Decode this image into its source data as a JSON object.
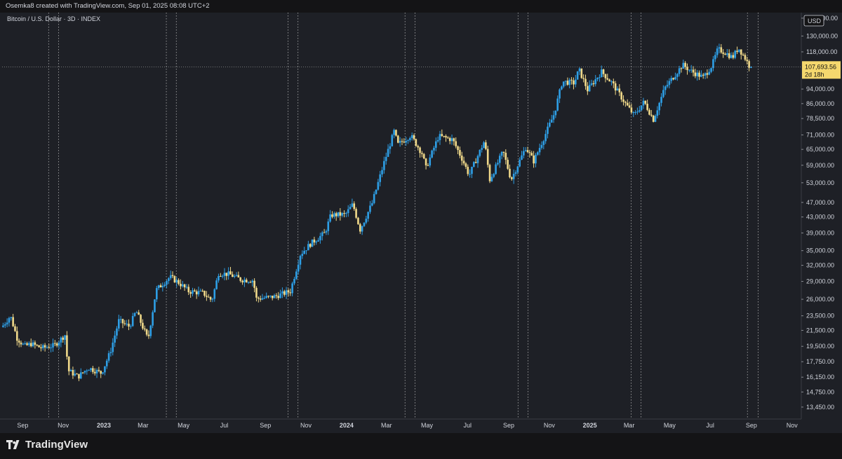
{
  "header": {
    "credit": "Osemka8 created with TradingView.com, Sep 01, 2025 08:08 UTC+2"
  },
  "footer": {
    "brand": "TradingView"
  },
  "colors": {
    "background": "#1e2026",
    "up": "#2e9fe6",
    "down": "#f0d98a",
    "grid": "#c8c8c8",
    "last_price_bg": "#f5d86e"
  },
  "chart_data": {
    "type": "candlestick",
    "title": "Bitcoin / U.S. Dollar · 3D · INDEX",
    "currency": "USD",
    "y_scale": "log",
    "ylim": [
      12500,
      150000
    ],
    "y_ticks": [
      "145,000.00",
      "130,000.00",
      "118,000.00",
      "94,000.00",
      "86,000.00",
      "78,500.00",
      "71,000.00",
      "65,000.00",
      "59,000.00",
      "53,000.00",
      "47,000.00",
      "43,000.00",
      "39,000.00",
      "35,000.00",
      "32,000.00",
      "29,000.00",
      "26,000.00",
      "23,500.00",
      "21,500.00",
      "19,500.00",
      "17,750.00",
      "16,150.00",
      "14,750.00",
      "13,450.00"
    ],
    "x_ticks": [
      {
        "date": "2022-09-01",
        "label": "Sep",
        "bold": false
      },
      {
        "date": "2022-11-01",
        "label": "Nov",
        "bold": false
      },
      {
        "date": "2023-01-01",
        "label": "2023",
        "bold": true
      },
      {
        "date": "2023-03-01",
        "label": "Mar",
        "bold": false
      },
      {
        "date": "2023-05-01",
        "label": "May",
        "bold": false
      },
      {
        "date": "2023-07-01",
        "label": "Jul",
        "bold": false
      },
      {
        "date": "2023-09-01",
        "label": "Sep",
        "bold": false
      },
      {
        "date": "2023-11-01",
        "label": "Nov",
        "bold": false
      },
      {
        "date": "2024-01-01",
        "label": "2024",
        "bold": true
      },
      {
        "date": "2024-03-01",
        "label": "Mar",
        "bold": false
      },
      {
        "date": "2024-05-01",
        "label": "May",
        "bold": false
      },
      {
        "date": "2024-07-01",
        "label": "Jul",
        "bold": false
      },
      {
        "date": "2024-09-01",
        "label": "Sep",
        "bold": false
      },
      {
        "date": "2024-11-01",
        "label": "Nov",
        "bold": false
      },
      {
        "date": "2025-01-01",
        "label": "2025",
        "bold": true
      },
      {
        "date": "2025-03-01",
        "label": "Mar",
        "bold": false
      },
      {
        "date": "2025-05-01",
        "label": "May",
        "bold": false
      },
      {
        "date": "2025-07-01",
        "label": "Jul",
        "bold": false
      },
      {
        "date": "2025-09-01",
        "label": "Sep",
        "bold": false
      },
      {
        "date": "2025-11-01",
        "label": "Nov",
        "bold": false
      }
    ],
    "x_range": [
      "2022-08-01",
      "2025-11-15"
    ],
    "vertical_markers": [
      "2022-10-10",
      "2022-10-25",
      "2023-04-05",
      "2023-04-20",
      "2023-10-05",
      "2023-10-20",
      "2024-03-29",
      "2024-04-13",
      "2024-09-15",
      "2024-09-30",
      "2025-03-04",
      "2025-03-19",
      "2025-08-26",
      "2025-09-11"
    ],
    "last_price": "107,693.56",
    "last_price_value": 107693.56,
    "countdown": "2d 18h",
    "price_path": [
      [
        "2022-08-01",
        21800
      ],
      [
        "2022-08-15",
        23500
      ],
      [
        "2022-08-25",
        20500
      ],
      [
        "2022-09-05",
        19500
      ],
      [
        "2022-09-15",
        19800
      ],
      [
        "2022-10-01",
        19300
      ],
      [
        "2022-10-20",
        19600
      ],
      [
        "2022-11-05",
        20900
      ],
      [
        "2022-11-10",
        16800
      ],
      [
        "2022-11-25",
        16200
      ],
      [
        "2022-12-10",
        17100
      ],
      [
        "2022-12-30",
        16550
      ],
      [
        "2023-01-12",
        18800
      ],
      [
        "2023-01-25",
        22800
      ],
      [
        "2023-02-10",
        22000
      ],
      [
        "2023-02-20",
        24200
      ],
      [
        "2023-03-10",
        20300
      ],
      [
        "2023-03-22",
        27500
      ],
      [
        "2023-04-12",
        29800
      ],
      [
        "2023-04-25",
        28800
      ],
      [
        "2023-05-10",
        27300
      ],
      [
        "2023-06-01",
        27000
      ],
      [
        "2023-06-14",
        25800
      ],
      [
        "2023-06-24",
        30500
      ],
      [
        "2023-07-10",
        30300
      ],
      [
        "2023-07-28",
        29300
      ],
      [
        "2023-08-15",
        29200
      ],
      [
        "2023-08-20",
        26100
      ],
      [
        "2023-09-15",
        26400
      ],
      [
        "2023-10-10",
        27300
      ],
      [
        "2023-10-25",
        34200
      ],
      [
        "2023-11-10",
        36600
      ],
      [
        "2023-12-01",
        39000
      ],
      [
        "2023-12-10",
        43500
      ],
      [
        "2024-01-01",
        43700
      ],
      [
        "2024-01-12",
        46500
      ],
      [
        "2024-01-23",
        39800
      ],
      [
        "2024-02-10",
        46800
      ],
      [
        "2024-02-28",
        60000
      ],
      [
        "2024-03-14",
        72500
      ],
      [
        "2024-03-20",
        67000
      ],
      [
        "2024-04-08",
        70800
      ],
      [
        "2024-04-25",
        63500
      ],
      [
        "2024-05-01",
        58000
      ],
      [
        "2024-05-20",
        70500
      ],
      [
        "2024-06-10",
        69000
      ],
      [
        "2024-06-25",
        61000
      ],
      [
        "2024-07-05",
        55500
      ],
      [
        "2024-07-28",
        68500
      ],
      [
        "2024-08-05",
        54000
      ],
      [
        "2024-08-25",
        64200
      ],
      [
        "2024-09-06",
        54000
      ],
      [
        "2024-09-28",
        65800
      ],
      [
        "2024-10-10",
        60500
      ],
      [
        "2024-10-28",
        71500
      ],
      [
        "2024-11-10",
        81000
      ],
      [
        "2024-11-22",
        98500
      ],
      [
        "2024-12-10",
        97500
      ],
      [
        "2024-12-17",
        106000
      ],
      [
        "2024-12-30",
        93500
      ],
      [
        "2025-01-20",
        104500
      ],
      [
        "2025-02-05",
        97500
      ],
      [
        "2025-02-25",
        86000
      ],
      [
        "2025-03-10",
        80000
      ],
      [
        "2025-03-25",
        87000
      ],
      [
        "2025-04-08",
        78000
      ],
      [
        "2025-04-25",
        94500
      ],
      [
        "2025-05-22",
        109000
      ],
      [
        "2025-06-05",
        104500
      ],
      [
        "2025-06-22",
        101000
      ],
      [
        "2025-07-05",
        108500
      ],
      [
        "2025-07-14",
        120000
      ],
      [
        "2025-07-25",
        117500
      ],
      [
        "2025-08-05",
        114000
      ],
      [
        "2025-08-14",
        121000
      ],
      [
        "2025-08-24",
        113500
      ],
      [
        "2025-08-31",
        107700
      ]
    ]
  }
}
